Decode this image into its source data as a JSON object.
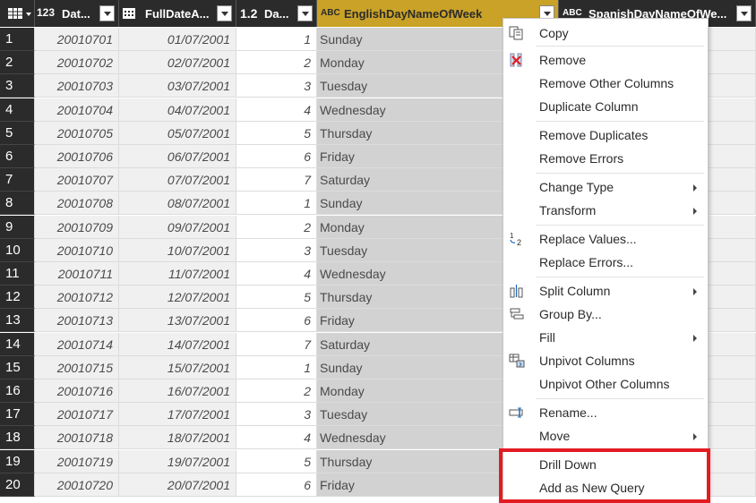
{
  "columns": [
    {
      "type_icon": "123",
      "name": "Dat..."
    },
    {
      "type_icon": "cal",
      "name": "FullDateA..."
    },
    {
      "type_icon": "1.2",
      "name": "Da..."
    },
    {
      "type_icon": "ABC",
      "name": "EnglishDayNameOfWeek"
    },
    {
      "type_icon": "ABC",
      "name": "SpanishDayNameOfWe..."
    }
  ],
  "rows": [
    {
      "idx": "1",
      "key": "20010701",
      "date": "01/07/2001",
      "num": "1",
      "day": "Sunday"
    },
    {
      "idx": "2",
      "key": "20010702",
      "date": "02/07/2001",
      "num": "2",
      "day": "Monday"
    },
    {
      "idx": "3",
      "key": "20010703",
      "date": "03/07/2001",
      "num": "3",
      "day": "Tuesday"
    },
    {
      "idx": "4",
      "key": "20010704",
      "date": "04/07/2001",
      "num": "4",
      "day": "Wednesday"
    },
    {
      "idx": "5",
      "key": "20010705",
      "date": "05/07/2001",
      "num": "5",
      "day": "Thursday"
    },
    {
      "idx": "6",
      "key": "20010706",
      "date": "06/07/2001",
      "num": "6",
      "day": "Friday"
    },
    {
      "idx": "7",
      "key": "20010707",
      "date": "07/07/2001",
      "num": "7",
      "day": "Saturday"
    },
    {
      "idx": "8",
      "key": "20010708",
      "date": "08/07/2001",
      "num": "1",
      "day": "Sunday"
    },
    {
      "idx": "9",
      "key": "20010709",
      "date": "09/07/2001",
      "num": "2",
      "day": "Monday"
    },
    {
      "idx": "10",
      "key": "20010710",
      "date": "10/07/2001",
      "num": "3",
      "day": "Tuesday"
    },
    {
      "idx": "11",
      "key": "20010711",
      "date": "11/07/2001",
      "num": "4",
      "day": "Wednesday"
    },
    {
      "idx": "12",
      "key": "20010712",
      "date": "12/07/2001",
      "num": "5",
      "day": "Thursday"
    },
    {
      "idx": "13",
      "key": "20010713",
      "date": "13/07/2001",
      "num": "6",
      "day": "Friday"
    },
    {
      "idx": "14",
      "key": "20010714",
      "date": "14/07/2001",
      "num": "7",
      "day": "Saturday"
    },
    {
      "idx": "15",
      "key": "20010715",
      "date": "15/07/2001",
      "num": "1",
      "day": "Sunday"
    },
    {
      "idx": "16",
      "key": "20010716",
      "date": "16/07/2001",
      "num": "2",
      "day": "Monday"
    },
    {
      "idx": "17",
      "key": "20010717",
      "date": "17/07/2001",
      "num": "3",
      "day": "Tuesday"
    },
    {
      "idx": "18",
      "key": "20010718",
      "date": "18/07/2001",
      "num": "4",
      "day": "Wednesday"
    },
    {
      "idx": "19",
      "key": "20010719",
      "date": "19/07/2001",
      "num": "5",
      "day": "Thursday"
    },
    {
      "idx": "20",
      "key": "20010720",
      "date": "20/07/2001",
      "num": "6",
      "day": "Friday"
    }
  ],
  "menu": {
    "copy": "Copy",
    "remove": "Remove",
    "remove_other": "Remove Other Columns",
    "duplicate": "Duplicate Column",
    "remove_duplicates": "Remove Duplicates",
    "remove_errors": "Remove Errors",
    "change_type": "Change Type",
    "transform": "Transform",
    "replace_values": "Replace Values...",
    "replace_errors": "Replace Errors...",
    "split_column": "Split Column",
    "group_by": "Group By...",
    "fill": "Fill",
    "unpivot": "Unpivot Columns",
    "unpivot_other": "Unpivot Other Columns",
    "rename": "Rename...",
    "move": "Move",
    "drill_down": "Drill Down",
    "add_query": "Add as New Query"
  },
  "colors": {
    "header_bg": "#2b2b2b",
    "selected_header": "#c9a227",
    "highlight_box": "#e31b23"
  }
}
